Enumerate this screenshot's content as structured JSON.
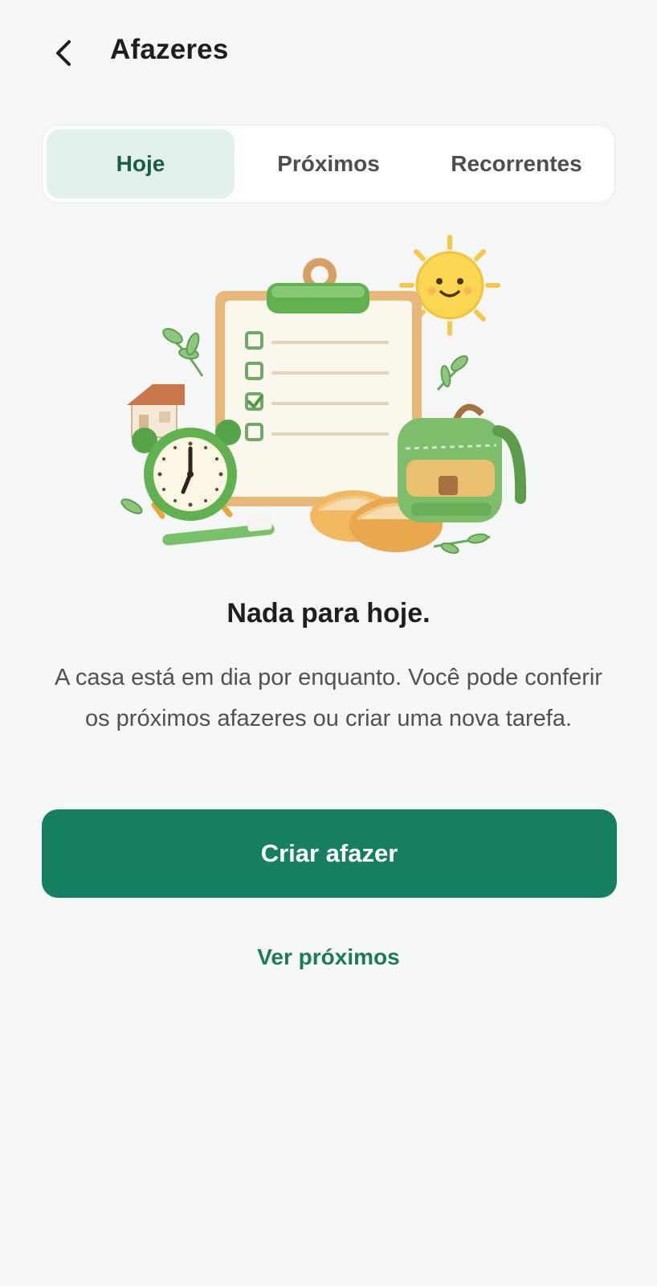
{
  "header": {
    "back_icon": "chevron-left-icon",
    "title": "Afazeres"
  },
  "tabs": [
    {
      "label": "Hoje",
      "active": true
    },
    {
      "label": "Próximos",
      "active": false
    },
    {
      "label": "Recorrentes",
      "active": false
    }
  ],
  "empty_state": {
    "title": "Nada para hoje.",
    "body": "A casa está em dia por enquanto. Você pode conferir os próximos afazeres ou criar uma nova tarefa."
  },
  "actions": {
    "primary_label": "Criar afazer",
    "secondary_label": "Ver próximos"
  },
  "colors": {
    "primary": "#167f62",
    "active_tab_bg": "#e2f2ea",
    "active_tab_text": "#1a5c44",
    "background": "#f5f7f6"
  }
}
